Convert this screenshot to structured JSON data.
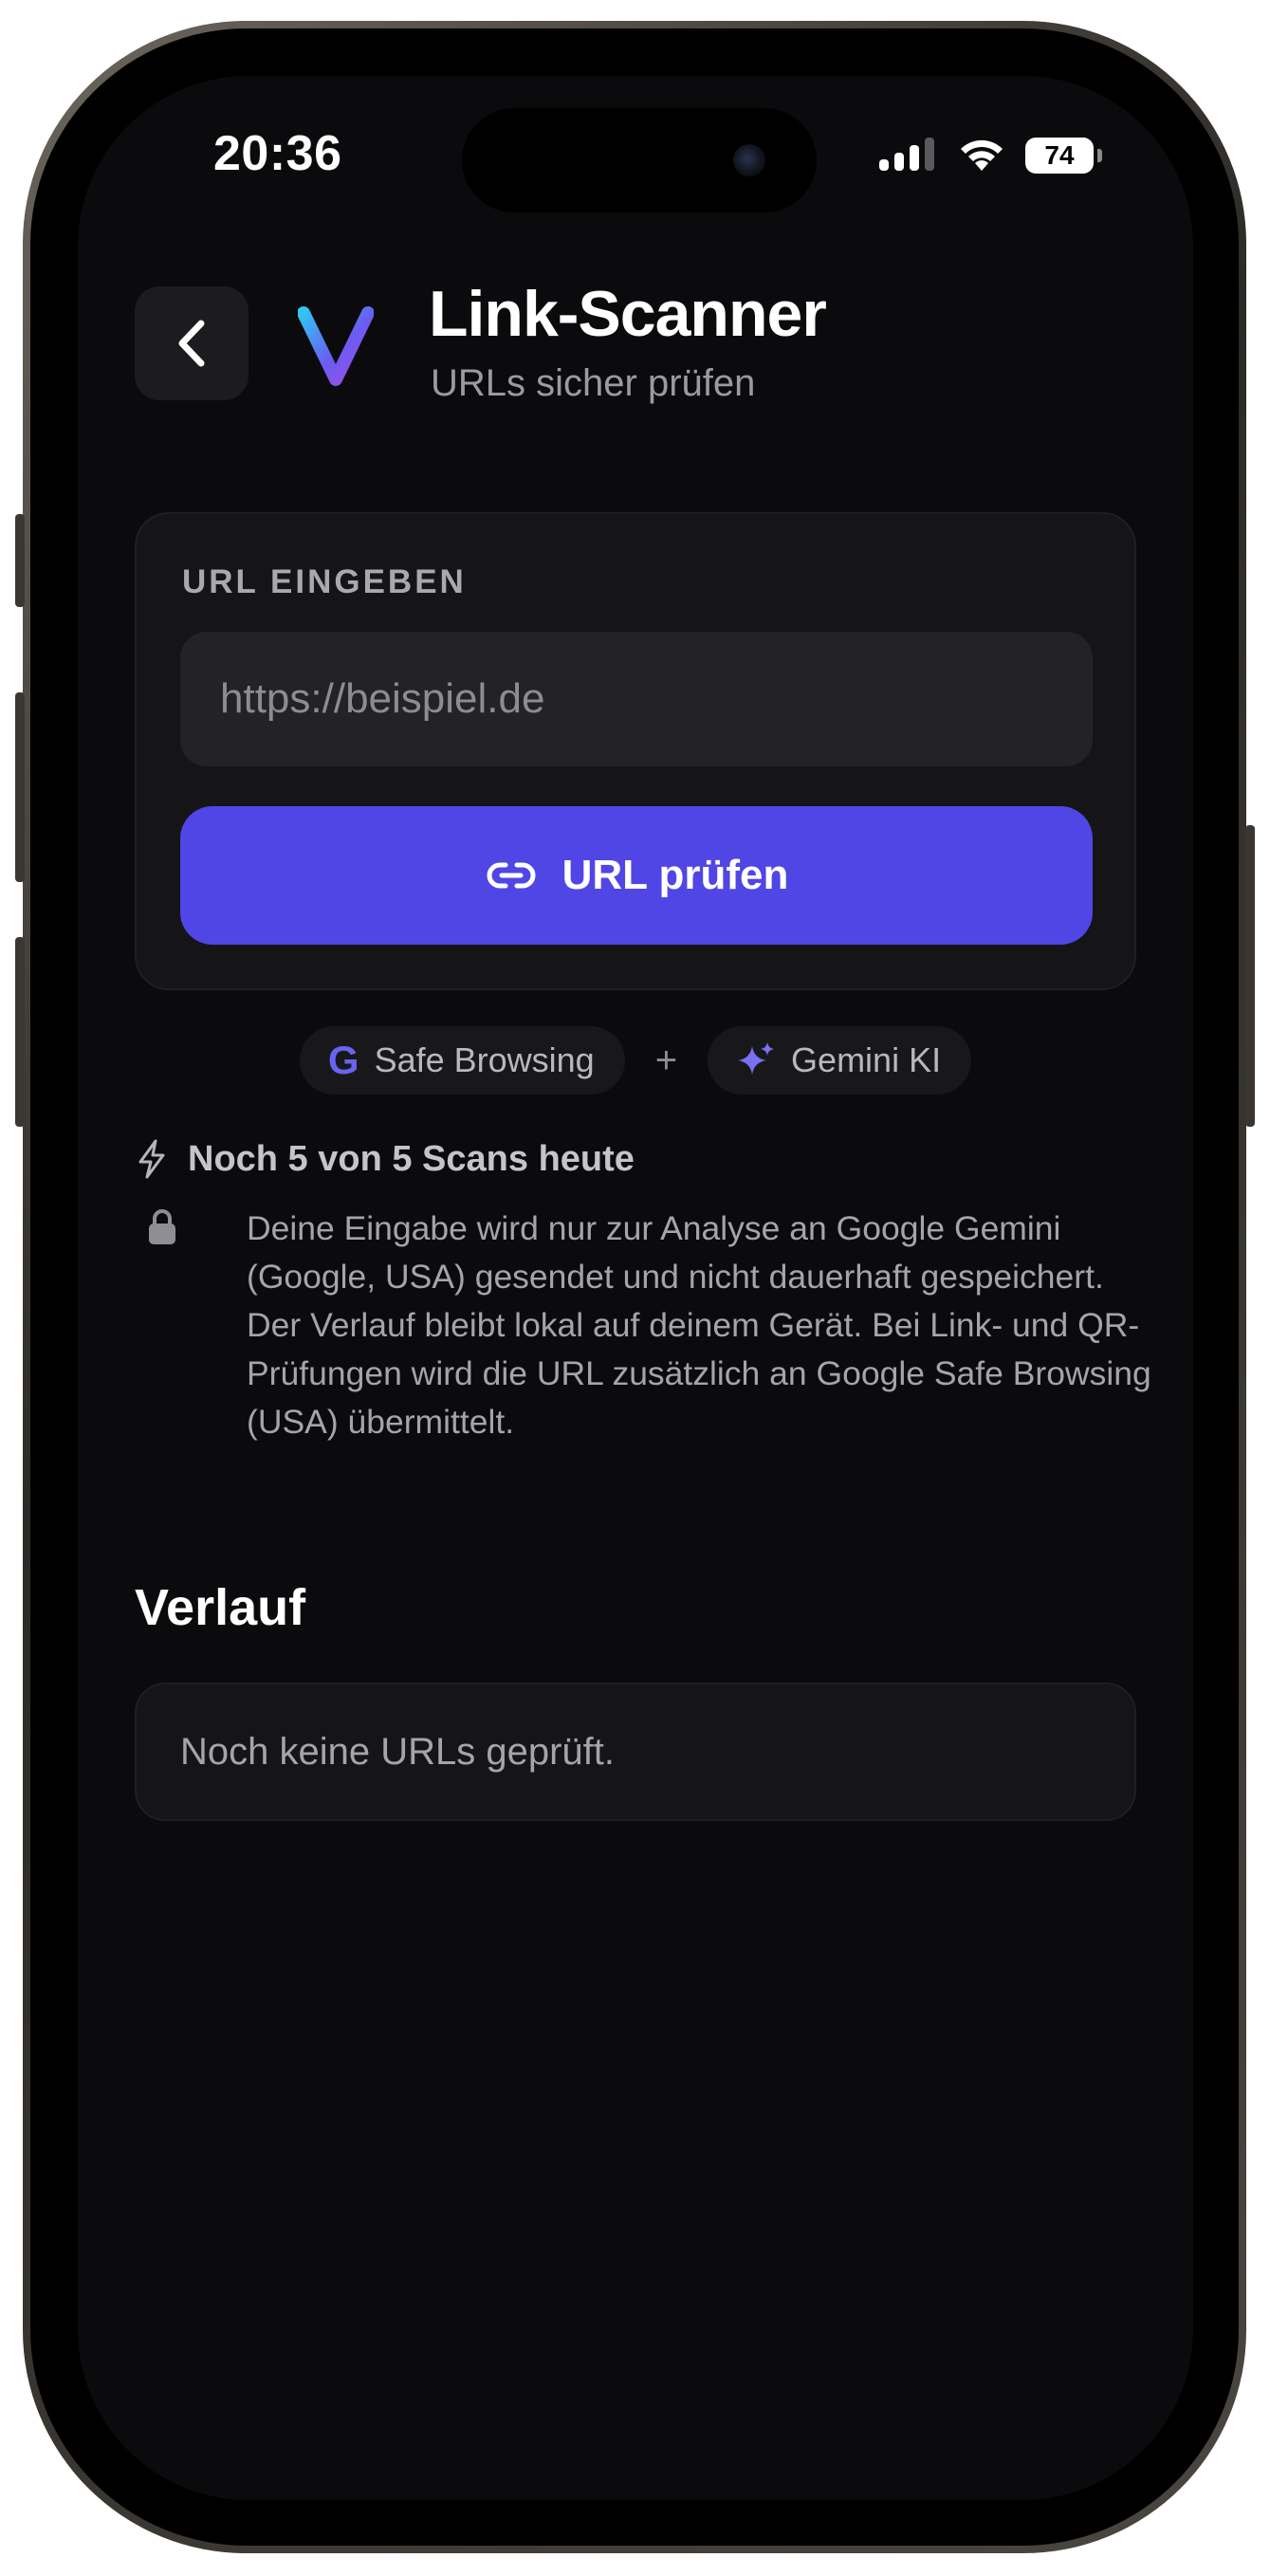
{
  "status_bar": {
    "time": "20:36",
    "battery": "74"
  },
  "header": {
    "title": "Link-Scanner",
    "subtitle": "URLs sicher prüfen"
  },
  "input_card": {
    "label": "URL EINGEBEN",
    "url_value": "",
    "url_placeholder": "https://beispiel.de",
    "submit_label": "URL prüfen"
  },
  "badges": {
    "safe_browsing": {
      "glyph": "G",
      "label": "Safe Browsing"
    },
    "plus": "+",
    "gemini": {
      "label": "Gemini KI"
    }
  },
  "quota": {
    "text": "Noch 5 von 5 Scans heute"
  },
  "privacy": {
    "text": "Deine Eingabe wird nur zur Analyse an Google Gemini (Google, USA) gesendet und nicht dauerhaft gespeichert. Der Verlauf bleibt lokal auf deinem Gerät. Bei Link- und QR-Prüfungen wird die URL zusätzlich an Google Safe Browsing (USA) übermittelt."
  },
  "history": {
    "title": "Verlauf",
    "empty_text": "Noch keine URLs geprüft."
  },
  "colors": {
    "background": "#0b0b0d",
    "card": "#151518",
    "accent": "#5046e5",
    "text_primary": "#ffffff",
    "text_secondary": "#a4a4aa"
  },
  "icons": {
    "back": "chevron-left-icon",
    "logo": "v-logo-icon",
    "button": "link-icon",
    "safe_browsing": "google-g-icon",
    "gemini": "sparkle-icon",
    "quota": "lightning-icon",
    "privacy": "lock-icon"
  }
}
